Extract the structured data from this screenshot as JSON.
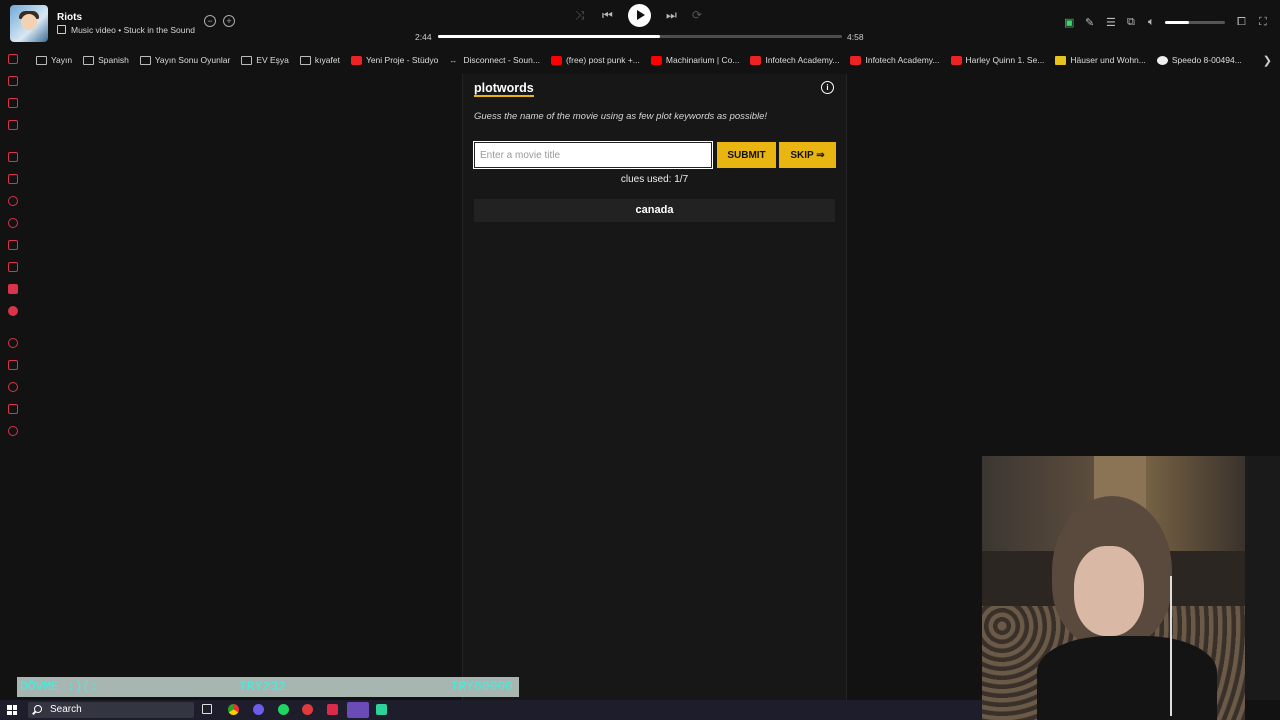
{
  "player": {
    "track_title": "Riots",
    "track_subtitle": "Music video • Stuck in the Sound",
    "time_current": "2:44",
    "time_total": "4:58",
    "progress_fraction": 0.55,
    "volume_fraction": 0.4
  },
  "bookmarks": [
    {
      "label": "Yayın",
      "icon": "folder-icon"
    },
    {
      "label": "Spanish",
      "icon": "folder-icon"
    },
    {
      "label": "Yayın Sonu Oyunlar",
      "icon": "folder-icon"
    },
    {
      "label": "EV Eşya",
      "icon": "folder-icon"
    },
    {
      "label": "kıyafet",
      "icon": "folder-icon"
    },
    {
      "label": "Yeni Proje - Stüdyo",
      "icon": "red-site-icon"
    },
    {
      "label": "Disconnect - Soun...",
      "icon": "link-icon"
    },
    {
      "label": "(free) post punk +...",
      "icon": "youtube-icon"
    },
    {
      "label": "Machinarium | Co...",
      "icon": "youtube-icon"
    },
    {
      "label": "Infotech Academy...",
      "icon": "red-site-icon"
    },
    {
      "label": "Infotech Academy...",
      "icon": "red-site-icon"
    },
    {
      "label": "Harley Quinn 1. Se...",
      "icon": "red-site-icon"
    },
    {
      "label": "Häuser und Wohn...",
      "icon": "yellow-site-icon"
    },
    {
      "label": "Speedo 8-00494...",
      "icon": "white-site-icon"
    }
  ],
  "game": {
    "logo": "plotwords",
    "tagline": "Guess the name of the movie using as few plot keywords as possible!",
    "input_placeholder": "Enter a movie title",
    "submit_label": "SUBMIT",
    "skip_label": "SKIP ⇒",
    "clues_used": "clues used: 1/7",
    "clues": [
      "canada"
    ]
  },
  "donation": {
    "left": "DÖVME :)(:",
    "middle": "TRY232",
    "right": "TRY60000"
  },
  "taskbar": {
    "search_label": "Search"
  },
  "colors": {
    "accent": "#e8b511",
    "background": "#121212",
    "donation_text": "#3ff0e0"
  }
}
